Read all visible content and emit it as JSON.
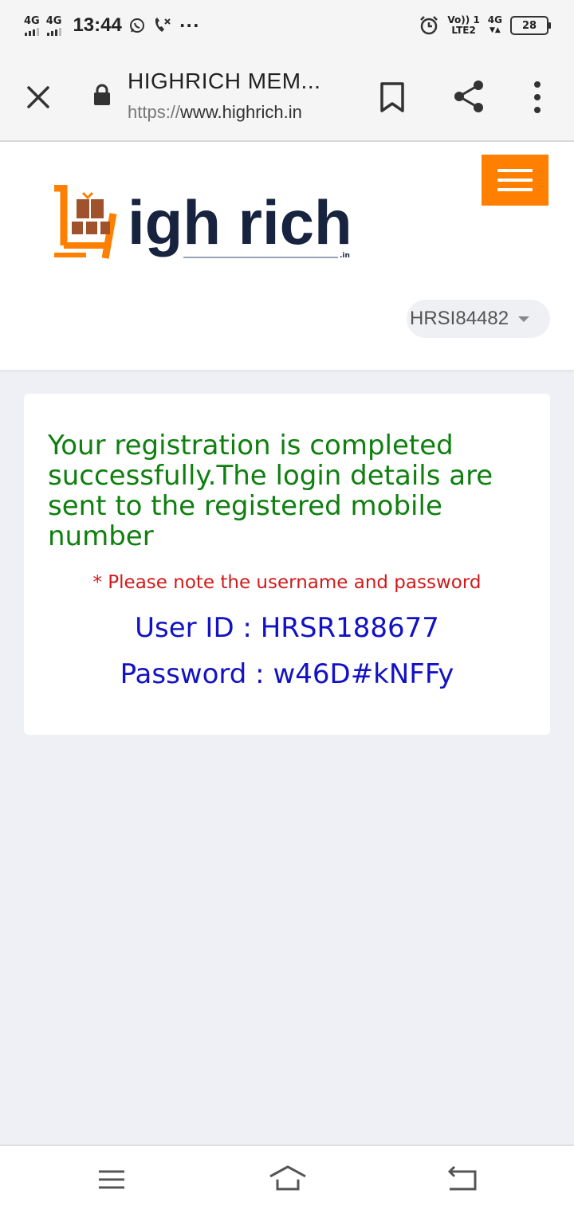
{
  "status_bar": {
    "network_1": "4G",
    "network_2": "4G",
    "time": "13:44",
    "volte_top": "Vo)) 1",
    "volte_bottom": "LTE2",
    "network_3": "4G",
    "battery": "28"
  },
  "browser": {
    "page_title": "HIGHRICH MEM...",
    "url_scheme": "https://",
    "url_host": "www.highrich.in"
  },
  "header": {
    "logo_text": "igh rich",
    "logo_suffix": ".in",
    "brand_color": "#ff7f00",
    "user_id": "HRSI84482"
  },
  "card": {
    "success_message": "Your registration is completed successfully.The login details are sent to the registered mobile number",
    "note": "* Please note the username and password",
    "user_id_line": "User ID : HRSR188677",
    "password_line": "Password : w46D#kNFFy"
  },
  "colors": {
    "success": "#0f7f0f",
    "note": "#d11a1a",
    "credentials": "#1212c4"
  }
}
